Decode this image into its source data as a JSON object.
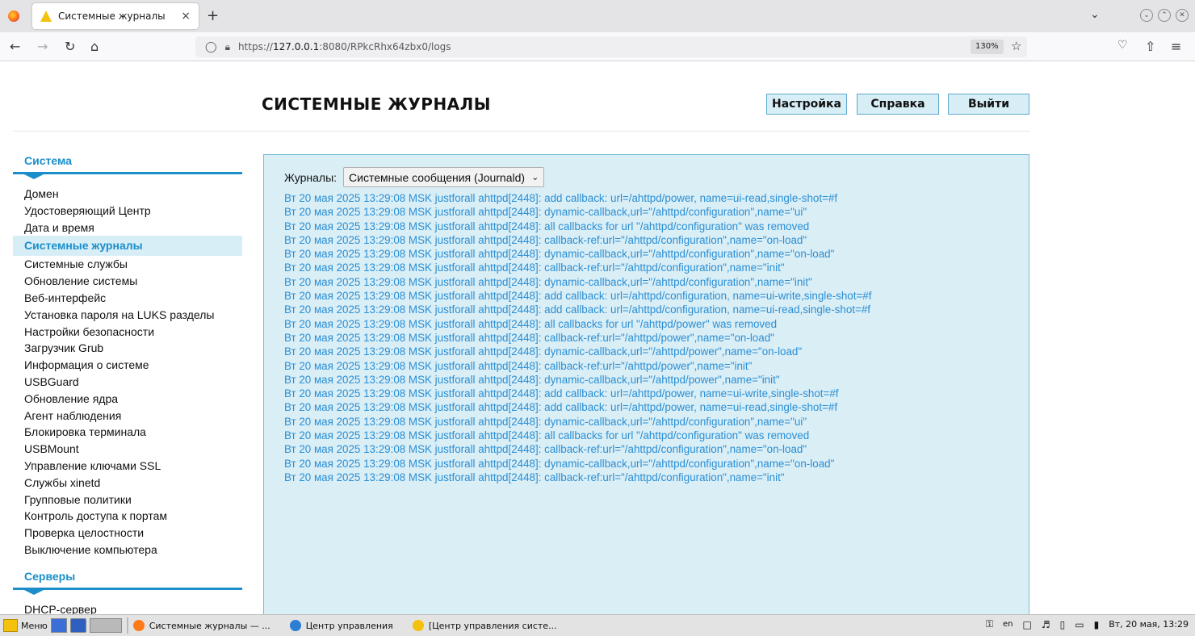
{
  "browser": {
    "tab_title": "Системные журналы",
    "tab_close": "×",
    "new_tab": "+",
    "url_prefix": "https://",
    "url_host": "127.0.0.1",
    "url_rest": ":8080/RPkcRhx64zbx0/logs",
    "zoom": "130%"
  },
  "page": {
    "title": "СИСТЕМНЫЕ ЖУРНАЛЫ",
    "buttons": {
      "settings": "Настройка",
      "help": "Справка",
      "logout": "Выйти"
    }
  },
  "sidebar": {
    "section_system": "Система",
    "items": [
      "Домен",
      "Удостоверяющий Центр",
      "Дата и время",
      "Системные журналы",
      "Системные службы",
      "Обновление системы",
      "Веб-интерфейс",
      "Установка пароля на LUKS разделы",
      "Настройки безопасности",
      "Загрузчик Grub",
      "Информация о системе",
      "USBGuard",
      "Обновление ядра",
      "Агент наблюдения",
      "Блокировка терминала",
      "USBMount",
      "Управление ключами SSL",
      "Службы xinetd",
      "Групповые политики",
      "Контроль доступа к портам",
      "Проверка целостности",
      "Выключение компьютера"
    ],
    "active_index": 3,
    "section_servers": "Серверы",
    "server_items": [
      "DHCP-сервер"
    ]
  },
  "journal": {
    "label": "Журналы:",
    "selected": "Системные сообщения (Journald)",
    "lines": [
      "Вт 20 мая 2025 13:29:08 MSK justforall ahttpd[2448]: add callback: url=/ahttpd/power, name=ui-read,single-shot=#f",
      "Вт 20 мая 2025 13:29:08 MSK justforall ahttpd[2448]: dynamic-callback,url=\"/ahttpd/configuration\",name=\"ui\"",
      "Вт 20 мая 2025 13:29:08 MSK justforall ahttpd[2448]: all callbacks for url \"/ahttpd/configuration\" was removed",
      "Вт 20 мая 2025 13:29:08 MSK justforall ahttpd[2448]: callback-ref:url=\"/ahttpd/configuration\",name=\"on-load\"",
      "Вт 20 мая 2025 13:29:08 MSK justforall ahttpd[2448]: dynamic-callback,url=\"/ahttpd/configuration\",name=\"on-load\"",
      "Вт 20 мая 2025 13:29:08 MSK justforall ahttpd[2448]: callback-ref:url=\"/ahttpd/configuration\",name=\"init\"",
      "Вт 20 мая 2025 13:29:08 MSK justforall ahttpd[2448]: dynamic-callback,url=\"/ahttpd/configuration\",name=\"init\"",
      "Вт 20 мая 2025 13:29:08 MSK justforall ahttpd[2448]: add callback: url=/ahttpd/configuration, name=ui-write,single-shot=#f",
      "Вт 20 мая 2025 13:29:08 MSK justforall ahttpd[2448]: add callback: url=/ahttpd/configuration, name=ui-read,single-shot=#f",
      "Вт 20 мая 2025 13:29:08 MSK justforall ahttpd[2448]: all callbacks for url \"/ahttpd/power\" was removed",
      "Вт 20 мая 2025 13:29:08 MSK justforall ahttpd[2448]: callback-ref:url=\"/ahttpd/power\",name=\"on-load\"",
      "Вт 20 мая 2025 13:29:08 MSK justforall ahttpd[2448]: dynamic-callback,url=\"/ahttpd/power\",name=\"on-load\"",
      "Вт 20 мая 2025 13:29:08 MSK justforall ahttpd[2448]: callback-ref:url=\"/ahttpd/power\",name=\"init\"",
      "Вт 20 мая 2025 13:29:08 MSK justforall ahttpd[2448]: dynamic-callback,url=\"/ahttpd/power\",name=\"init\"",
      "Вт 20 мая 2025 13:29:08 MSK justforall ahttpd[2448]: add callback: url=/ahttpd/power, name=ui-write,single-shot=#f",
      "Вт 20 мая 2025 13:29:08 MSK justforall ahttpd[2448]: add callback: url=/ahttpd/power, name=ui-read,single-shot=#f",
      "Вт 20 мая 2025 13:29:08 MSK justforall ahttpd[2448]: dynamic-callback,url=\"/ahttpd/configuration\",name=\"ui\"",
      "Вт 20 мая 2025 13:29:08 MSK justforall ahttpd[2448]: all callbacks for url \"/ahttpd/configuration\" was removed",
      "Вт 20 мая 2025 13:29:08 MSK justforall ahttpd[2448]: callback-ref:url=\"/ahttpd/configuration\",name=\"on-load\"",
      "Вт 20 мая 2025 13:29:08 MSK justforall ahttpd[2448]: dynamic-callback,url=\"/ahttpd/configuration\",name=\"on-load\"",
      "Вт 20 мая 2025 13:29:08 MSK justforall ahttpd[2448]: callback-ref:url=\"/ahttpd/configuration\",name=\"init\""
    ]
  },
  "taskbar": {
    "menu_label": "Меню",
    "tasks": [
      "Системные журналы — ...",
      "Центр управления",
      "[Центр управления систе..."
    ],
    "lang": "en",
    "clock": "Вт, 20 мая, 13:29"
  },
  "colors": {
    "accent": "#1b8ec9",
    "log_text": "#2a8fd4",
    "panel_bg": "#daeef6",
    "button_bg": "#d7eef7"
  },
  "icons": {
    "back": "arrow-left-icon",
    "forward": "arrow-right-icon",
    "reload": "reload-icon",
    "home": "home-icon",
    "bookmark": "star-icon",
    "pocket": "pocket-icon",
    "share": "share-icon",
    "menu": "hamburger-icon"
  }
}
